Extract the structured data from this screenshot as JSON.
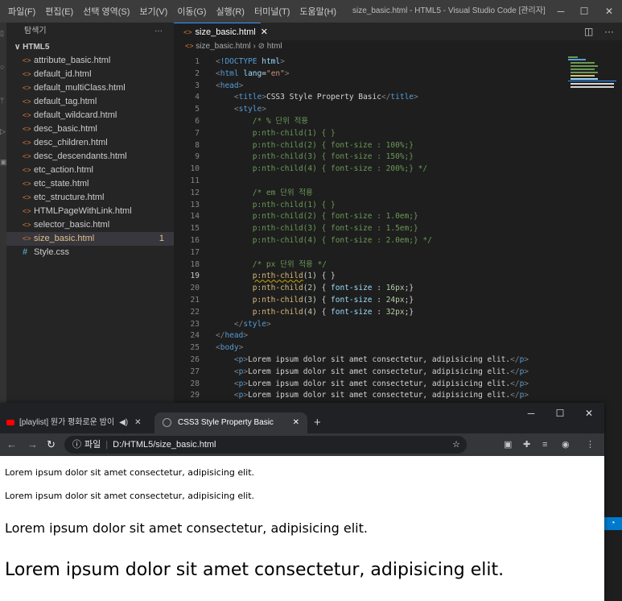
{
  "vscode": {
    "menu": [
      "파일(F)",
      "편집(E)",
      "선택 영역(S)",
      "보기(V)",
      "이동(G)",
      "실행(R)",
      "터미널(T)",
      "도움말(H)"
    ],
    "window_title": "size_basic.html - HTML5 - Visual Studio Code [관리자]",
    "explorer": {
      "header": "탐색기",
      "folder": "HTML5",
      "files": [
        {
          "name": "attribute_basic.html",
          "type": "html"
        },
        {
          "name": "default_id.html",
          "type": "html"
        },
        {
          "name": "default_multiClass.html",
          "type": "html"
        },
        {
          "name": "default_tag.html",
          "type": "html"
        },
        {
          "name": "default_wildcard.html",
          "type": "html"
        },
        {
          "name": "desc_basic.html",
          "type": "html"
        },
        {
          "name": "desc_children.html",
          "type": "html"
        },
        {
          "name": "desc_descendants.html",
          "type": "html"
        },
        {
          "name": "etc_action.html",
          "type": "html"
        },
        {
          "name": "etc_state.html",
          "type": "html"
        },
        {
          "name": "etc_structure.html",
          "type": "html"
        },
        {
          "name": "HTMLPageWithLink.html",
          "type": "html"
        },
        {
          "name": "selector_basic.html",
          "type": "html"
        },
        {
          "name": "size_basic.html",
          "type": "html",
          "active": true,
          "badge": "1"
        },
        {
          "name": "Style.css",
          "type": "css"
        }
      ]
    },
    "tab": {
      "label": "size_basic.html"
    },
    "breadcrumb": {
      "file": "size_basic.html",
      "node": "html"
    },
    "code_lines": [
      {
        "n": "1",
        "html": "<span class='punc'>&lt;</span><span class='tag'>!DOCTYPE</span> <span class='attr'>html</span><span class='punc'>&gt;</span>"
      },
      {
        "n": "2",
        "html": "<span class='punc'>&lt;</span><span class='tag'>html</span> <span class='attr'>lang</span>=<span class='str'>\"en\"</span><span class='punc'>&gt;</span>"
      },
      {
        "n": "3",
        "html": "<span class='punc'>&lt;</span><span class='tag'>head</span><span class='punc'>&gt;</span>"
      },
      {
        "n": "4",
        "html": "    <span class='punc'>&lt;</span><span class='tag'>title</span><span class='punc'>&gt;</span>CSS3 Style Property Basic<span class='punc'>&lt;/</span><span class='tag'>title</span><span class='punc'>&gt;</span>"
      },
      {
        "n": "5",
        "html": "    <span class='punc'>&lt;</span><span class='tag'>style</span><span class='punc'>&gt;</span>"
      },
      {
        "n": "6",
        "html": "        <span class='cmt'>/* % 단위 적용</span>"
      },
      {
        "n": "7",
        "html": "        <span class='cmt'>p:nth-child(1) { }</span>"
      },
      {
        "n": "8",
        "html": "        <span class='cmt'>p:nth-child(2) { font-size : 100%;}</span>"
      },
      {
        "n": "9",
        "html": "        <span class='cmt'>p:nth-child(3) { font-size : 150%;}</span>"
      },
      {
        "n": "10",
        "html": "        <span class='cmt'>p:nth-child(4) { font-size : 200%;} */</span>"
      },
      {
        "n": "11",
        "html": ""
      },
      {
        "n": "12",
        "html": "        <span class='cmt'>/* em 단위 적용</span>"
      },
      {
        "n": "13",
        "html": "        <span class='cmt'>p:nth-child(1) { }</span>"
      },
      {
        "n": "14",
        "html": "        <span class='cmt'>p:nth-child(2) { font-size : 1.0em;}</span>"
      },
      {
        "n": "15",
        "html": "        <span class='cmt'>p:nth-child(3) { font-size : 1.5em;}</span>"
      },
      {
        "n": "16",
        "html": "        <span class='cmt'>p:nth-child(4) { font-size : 2.0em;} */</span>"
      },
      {
        "n": "17",
        "html": ""
      },
      {
        "n": "18",
        "html": "        <span class='cmt'>/* px 단위 적용 */</span>"
      },
      {
        "n": "19",
        "html": "        <span class='sel squig'>p:nth-child</span><span class='plain'>(</span><span class='num2'>1</span><span class='plain'>) { }</span>"
      },
      {
        "n": "20",
        "html": "        <span class='sel'>p:nth-child</span><span class='plain'>(</span><span class='num2'>2</span><span class='plain'>) { </span><span class='prop'>font-size</span><span class='plain'> : </span><span class='num2'>16px</span><span class='plain'>;}</span>"
      },
      {
        "n": "21",
        "html": "        <span class='sel'>p:nth-child</span><span class='plain'>(</span><span class='num2'>3</span><span class='plain'>) { </span><span class='prop'>font-size</span><span class='plain'> : </span><span class='num2'>24px</span><span class='plain'>;}</span>"
      },
      {
        "n": "22",
        "html": "        <span class='sel'>p:nth-child</span><span class='plain'>(</span><span class='num2'>4</span><span class='plain'>) { </span><span class='prop'>font-size</span><span class='plain'> : </span><span class='num2'>32px</span><span class='plain'>;}</span>"
      },
      {
        "n": "23",
        "html": "    <span class='punc'>&lt;/</span><span class='tag'>style</span><span class='punc'>&gt;</span>"
      },
      {
        "n": "24",
        "html": "<span class='punc'>&lt;/</span><span class='tag'>head</span><span class='punc'>&gt;</span>"
      },
      {
        "n": "25",
        "html": "<span class='punc'>&lt;</span><span class='tag'>body</span><span class='punc'>&gt;</span>"
      },
      {
        "n": "26",
        "html": "    <span class='punc'>&lt;</span><span class='tag'>p</span><span class='punc'>&gt;</span>Lorem ipsum dolor sit amet consectetur, adipisicing elit.<span class='punc'>&lt;/</span><span class='tag'>p</span><span class='punc'>&gt;</span>"
      },
      {
        "n": "27",
        "html": "    <span class='punc'>&lt;</span><span class='tag'>p</span><span class='punc'>&gt;</span>Lorem ipsum dolor sit amet consectetur, adipisicing elit.<span class='punc'>&lt;/</span><span class='tag'>p</span><span class='punc'>&gt;</span>"
      },
      {
        "n": "28",
        "html": "    <span class='punc'>&lt;</span><span class='tag'>p</span><span class='punc'>&gt;</span>Lorem ipsum dolor sit amet consectetur, adipisicing elit.<span class='punc'>&lt;/</span><span class='tag'>p</span><span class='punc'>&gt;</span>"
      },
      {
        "n": "29",
        "html": "    <span class='punc'>&lt;</span><span class='tag'>p</span><span class='punc'>&gt;</span>Lorem ipsum dolor sit amet consectetur, adipisicing elit.<span class='punc'>&lt;/</span><span class='tag'>p</span><span class='punc'>&gt;</span>"
      }
    ]
  },
  "browser": {
    "tab1_title": "[playlist] 뭔가 평화로운 밤이",
    "tab2_title": "CSS3 Style Property Basic",
    "new_tab": "+",
    "omnibox": {
      "scheme_label": "파일",
      "url": "D:/HTML5/size_basic.html"
    },
    "paragraphs": [
      "Lorem ipsum dolor sit amet consectetur, adipisicing elit.",
      "Lorem ipsum dolor sit amet consectetur, adipisicing elit.",
      "Lorem ipsum dolor sit amet consectetur, adipisicing elit.",
      "Lorem ipsum dolor sit amet consectetur, adipisicing elit."
    ]
  },
  "colors": {
    "accent": "#007acc",
    "comment": "#6a9955",
    "selector": "#d7ba7d",
    "keyword": "#569cd6",
    "string": "#ce9178"
  },
  "icons": [
    "files-icon",
    "search-icon",
    "source-control-icon",
    "run-icon",
    "extensions-icon",
    "html-file-icon",
    "css-file-icon",
    "split-editor-icon",
    "more-icon",
    "back-icon",
    "forward-icon",
    "reload-icon",
    "info-icon",
    "star-icon",
    "extension-puzzle-icon",
    "media-icon",
    "profile-icon",
    "menu-icon",
    "bell-icon"
  ]
}
